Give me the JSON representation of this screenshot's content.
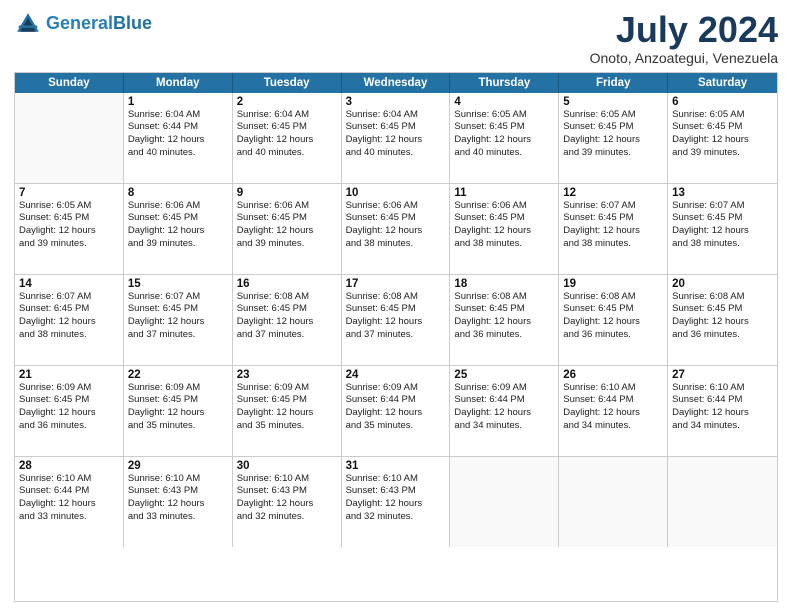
{
  "logo": {
    "line1": "General",
    "line2": "Blue"
  },
  "title": "July 2024",
  "subtitle": "Onoto, Anzoategui, Venezuela",
  "header_days": [
    "Sunday",
    "Monday",
    "Tuesday",
    "Wednesday",
    "Thursday",
    "Friday",
    "Saturday"
  ],
  "weeks": [
    [
      {
        "day": "",
        "info": ""
      },
      {
        "day": "1",
        "info": "Sunrise: 6:04 AM\nSunset: 6:44 PM\nDaylight: 12 hours\nand 40 minutes."
      },
      {
        "day": "2",
        "info": "Sunrise: 6:04 AM\nSunset: 6:45 PM\nDaylight: 12 hours\nand 40 minutes."
      },
      {
        "day": "3",
        "info": "Sunrise: 6:04 AM\nSunset: 6:45 PM\nDaylight: 12 hours\nand 40 minutes."
      },
      {
        "day": "4",
        "info": "Sunrise: 6:05 AM\nSunset: 6:45 PM\nDaylight: 12 hours\nand 40 minutes."
      },
      {
        "day": "5",
        "info": "Sunrise: 6:05 AM\nSunset: 6:45 PM\nDaylight: 12 hours\nand 39 minutes."
      },
      {
        "day": "6",
        "info": "Sunrise: 6:05 AM\nSunset: 6:45 PM\nDaylight: 12 hours\nand 39 minutes."
      }
    ],
    [
      {
        "day": "7",
        "info": "Sunrise: 6:05 AM\nSunset: 6:45 PM\nDaylight: 12 hours\nand 39 minutes."
      },
      {
        "day": "8",
        "info": "Sunrise: 6:06 AM\nSunset: 6:45 PM\nDaylight: 12 hours\nand 39 minutes."
      },
      {
        "day": "9",
        "info": "Sunrise: 6:06 AM\nSunset: 6:45 PM\nDaylight: 12 hours\nand 39 minutes."
      },
      {
        "day": "10",
        "info": "Sunrise: 6:06 AM\nSunset: 6:45 PM\nDaylight: 12 hours\nand 38 minutes."
      },
      {
        "day": "11",
        "info": "Sunrise: 6:06 AM\nSunset: 6:45 PM\nDaylight: 12 hours\nand 38 minutes."
      },
      {
        "day": "12",
        "info": "Sunrise: 6:07 AM\nSunset: 6:45 PM\nDaylight: 12 hours\nand 38 minutes."
      },
      {
        "day": "13",
        "info": "Sunrise: 6:07 AM\nSunset: 6:45 PM\nDaylight: 12 hours\nand 38 minutes."
      }
    ],
    [
      {
        "day": "14",
        "info": "Sunrise: 6:07 AM\nSunset: 6:45 PM\nDaylight: 12 hours\nand 38 minutes."
      },
      {
        "day": "15",
        "info": "Sunrise: 6:07 AM\nSunset: 6:45 PM\nDaylight: 12 hours\nand 37 minutes."
      },
      {
        "day": "16",
        "info": "Sunrise: 6:08 AM\nSunset: 6:45 PM\nDaylight: 12 hours\nand 37 minutes."
      },
      {
        "day": "17",
        "info": "Sunrise: 6:08 AM\nSunset: 6:45 PM\nDaylight: 12 hours\nand 37 minutes."
      },
      {
        "day": "18",
        "info": "Sunrise: 6:08 AM\nSunset: 6:45 PM\nDaylight: 12 hours\nand 36 minutes."
      },
      {
        "day": "19",
        "info": "Sunrise: 6:08 AM\nSunset: 6:45 PM\nDaylight: 12 hours\nand 36 minutes."
      },
      {
        "day": "20",
        "info": "Sunrise: 6:08 AM\nSunset: 6:45 PM\nDaylight: 12 hours\nand 36 minutes."
      }
    ],
    [
      {
        "day": "21",
        "info": "Sunrise: 6:09 AM\nSunset: 6:45 PM\nDaylight: 12 hours\nand 36 minutes."
      },
      {
        "day": "22",
        "info": "Sunrise: 6:09 AM\nSunset: 6:45 PM\nDaylight: 12 hours\nand 35 minutes."
      },
      {
        "day": "23",
        "info": "Sunrise: 6:09 AM\nSunset: 6:45 PM\nDaylight: 12 hours\nand 35 minutes."
      },
      {
        "day": "24",
        "info": "Sunrise: 6:09 AM\nSunset: 6:44 PM\nDaylight: 12 hours\nand 35 minutes."
      },
      {
        "day": "25",
        "info": "Sunrise: 6:09 AM\nSunset: 6:44 PM\nDaylight: 12 hours\nand 34 minutes."
      },
      {
        "day": "26",
        "info": "Sunrise: 6:10 AM\nSunset: 6:44 PM\nDaylight: 12 hours\nand 34 minutes."
      },
      {
        "day": "27",
        "info": "Sunrise: 6:10 AM\nSunset: 6:44 PM\nDaylight: 12 hours\nand 34 minutes."
      }
    ],
    [
      {
        "day": "28",
        "info": "Sunrise: 6:10 AM\nSunset: 6:44 PM\nDaylight: 12 hours\nand 33 minutes."
      },
      {
        "day": "29",
        "info": "Sunrise: 6:10 AM\nSunset: 6:43 PM\nDaylight: 12 hours\nand 33 minutes."
      },
      {
        "day": "30",
        "info": "Sunrise: 6:10 AM\nSunset: 6:43 PM\nDaylight: 12 hours\nand 32 minutes."
      },
      {
        "day": "31",
        "info": "Sunrise: 6:10 AM\nSunset: 6:43 PM\nDaylight: 12 hours\nand 32 minutes."
      },
      {
        "day": "",
        "info": ""
      },
      {
        "day": "",
        "info": ""
      },
      {
        "day": "",
        "info": ""
      }
    ]
  ]
}
